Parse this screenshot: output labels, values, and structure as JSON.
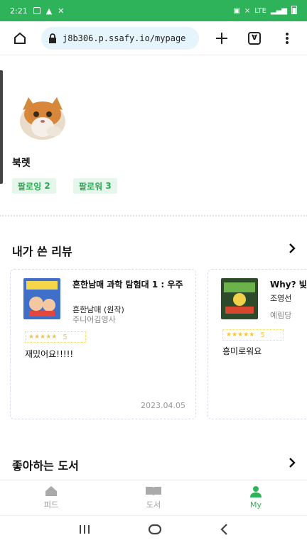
{
  "status": {
    "time": "2:21",
    "badge": "LTE",
    "battery_level": 0.8
  },
  "browser": {
    "url": "j8b306.p.ssafy.io/mypage",
    "tab_count": "∀"
  },
  "profile": {
    "nickname": "북렛",
    "following_label": "팔로잉",
    "following_count": "2",
    "follower_label": "팔로워",
    "follower_count": "3"
  },
  "reviews_section": {
    "title": "내가 쓴 리뷰"
  },
  "reviews": [
    {
      "title": "흔한남매 과학 탐험대 1 : 우주",
      "author": "흔한남매 (원작)",
      "publisher": "주니어김영사",
      "stars": "★★★★★",
      "score": "5",
      "text": "재밌어요!!!!!",
      "date": "2023.04.05"
    },
    {
      "title": "Why? 빛",
      "author": "조영선",
      "publisher": "예림당",
      "stars": "★★★★★",
      "score": "5",
      "text": "흥미로워요",
      "date": ""
    }
  ],
  "liked_section": {
    "title": "좋아하는 도서"
  },
  "nav": {
    "feed": "피드",
    "books": "도서",
    "my": "My"
  },
  "colors": {
    "accent": "#2fb35a",
    "chip_bg": "#e4f7ea",
    "star": "#f4c542"
  }
}
